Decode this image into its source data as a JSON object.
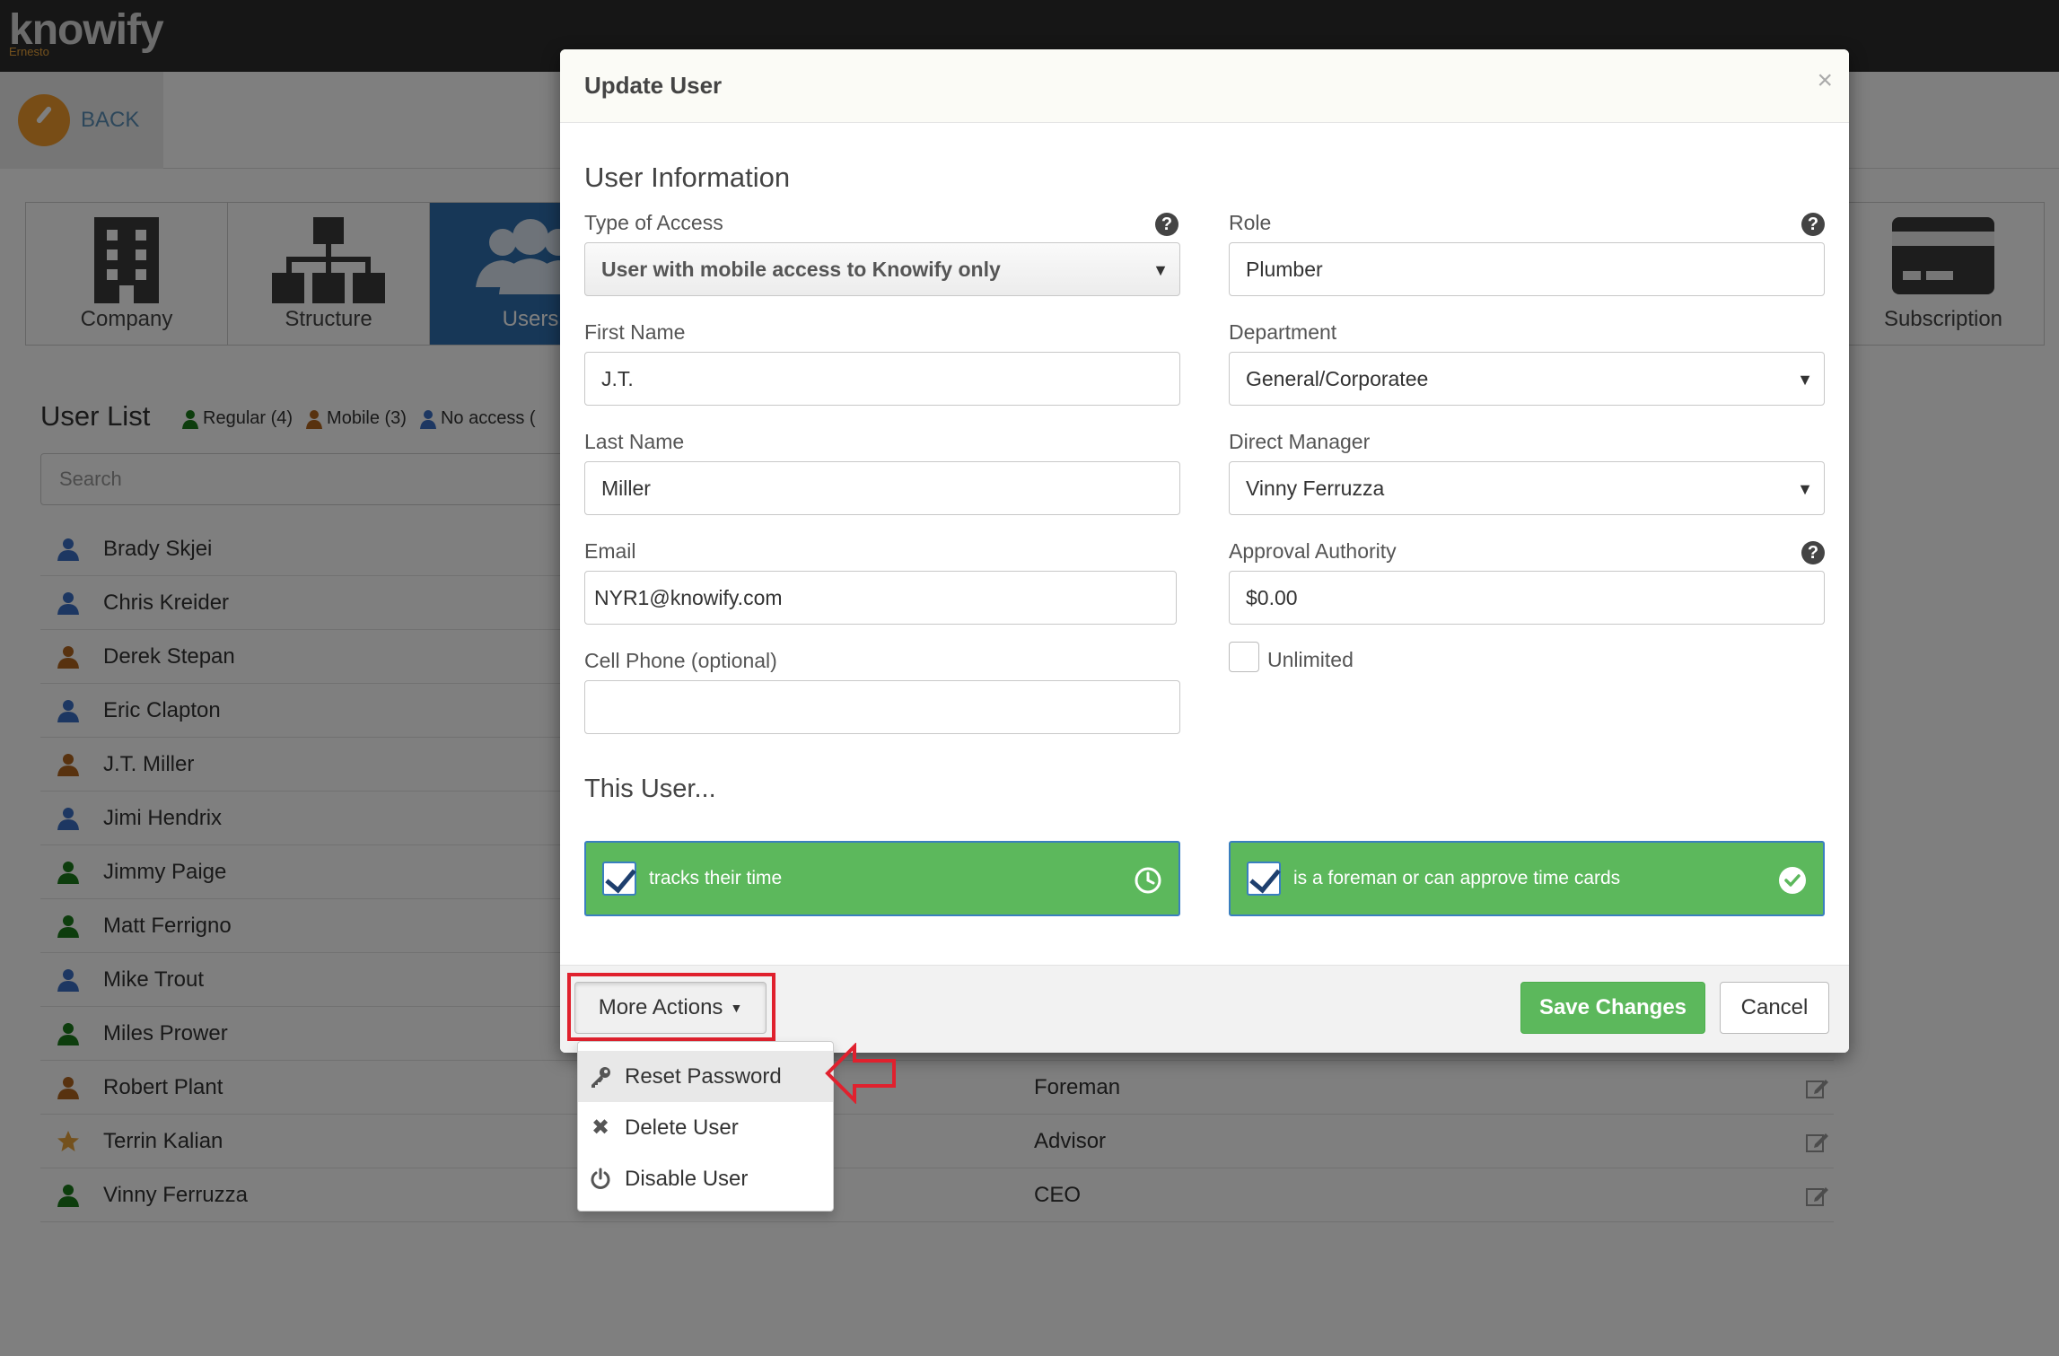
{
  "app": {
    "logo": "knowify",
    "logo_sub": "Ernesto",
    "back_label": "BACK"
  },
  "tiles": [
    {
      "label": "Company"
    },
    {
      "label": "Structure"
    },
    {
      "label": "Users"
    },
    {
      "label": "Subscription"
    }
  ],
  "user_list": {
    "title": "User List",
    "legend": {
      "regular": "Regular (4)",
      "mobile": "Mobile (3)",
      "no_access": "No access ("
    },
    "search_placeholder": "Search",
    "rows": [
      {
        "name": "Brady Skjei",
        "type": "regular",
        "role": ""
      },
      {
        "name": "Chris Kreider",
        "type": "regular",
        "role": ""
      },
      {
        "name": "Derek Stepan",
        "type": "mobile",
        "role": ""
      },
      {
        "name": "Eric Clapton",
        "type": "regular",
        "role": ""
      },
      {
        "name": "J.T. Miller",
        "type": "mobile",
        "role": ""
      },
      {
        "name": "Jimi Hendrix",
        "type": "regular",
        "role": ""
      },
      {
        "name": "Jimmy Paige",
        "type": "green",
        "role": ""
      },
      {
        "name": "Matt Ferrigno",
        "type": "green",
        "role": ""
      },
      {
        "name": "Mike Trout",
        "type": "regular",
        "role": ""
      },
      {
        "name": "Miles Prower",
        "type": "green",
        "role": ""
      },
      {
        "name": "Robert Plant",
        "type": "mobile",
        "role": "Foreman"
      },
      {
        "name": "Terrin Kalian",
        "type": "star",
        "role": "Advisor"
      },
      {
        "name": "Vinny Ferruzza",
        "type": "green",
        "role": "CEO"
      }
    ]
  },
  "modal": {
    "title": "Update User",
    "close": "×",
    "section_info": "User Information",
    "type_of_access": {
      "label": "Type of Access",
      "value": "User with mobile access to Knowify only"
    },
    "role": {
      "label": "Role",
      "value": "Plumber"
    },
    "first_name": {
      "label": "First Name",
      "value": "J.T."
    },
    "department": {
      "label": "Department",
      "value": "General/Corporatee"
    },
    "last_name": {
      "label": "Last Name",
      "value": "Miller"
    },
    "direct_manager": {
      "label": "Direct Manager",
      "value": "Vinny Ferruzza"
    },
    "email": {
      "label": "Email",
      "value": "NYR1@knowify.com"
    },
    "approval_authority": {
      "label": "Approval Authority",
      "value": "$0.00"
    },
    "cell_phone": {
      "label": "Cell Phone (optional)",
      "value": ""
    },
    "unlimited": {
      "label": "Unlimited",
      "checked": false
    },
    "section_this_user": "This User...",
    "tracks_time": {
      "label": "tracks their time",
      "checked": true
    },
    "foreman": {
      "label": "is a foreman or can approve time cards",
      "checked": true
    },
    "help_glyph": "?",
    "footer": {
      "more_actions": "More Actions",
      "save": "Save Changes",
      "cancel": "Cancel"
    },
    "dropdown": [
      {
        "label": "Reset Password",
        "icon": "key-icon"
      },
      {
        "label": "Delete User",
        "icon": "x-icon"
      },
      {
        "label": "Disable User",
        "icon": "power-icon"
      }
    ]
  },
  "colors": {
    "accent_blue": "#2f6fae",
    "success_green": "#5cb85c",
    "highlight_red": "#e0212e",
    "brand_orange": "#f09a2c"
  }
}
